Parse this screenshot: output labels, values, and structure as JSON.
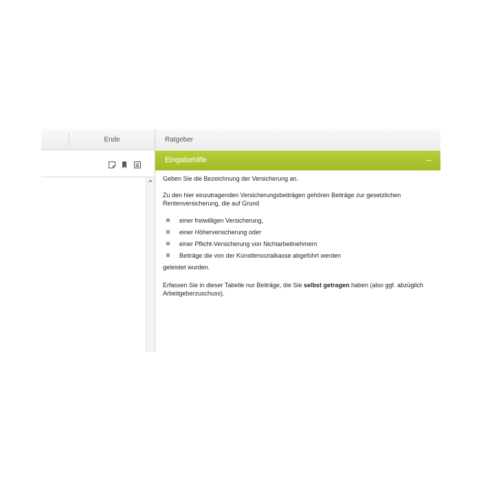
{
  "left": {
    "tab_label": "Ende",
    "toolbar_icons": [
      "note-icon",
      "bookmark-icon",
      "document-icon"
    ]
  },
  "right": {
    "tab_label": "Ratgeber",
    "panel_title": "Eingabehilfe",
    "content": {
      "p1": "Geben Sie die Bezeichnung der Versicherung an.",
      "p2": "Zu den hier einzutragenden Versicherungsbeiträgen gehören Beiträge zur gesetzlichen Rentenversicherung, die auf Grund",
      "list": [
        "einer freiwilligen Versicherung,",
        "einer Höherversicherung oder",
        "einer Pflicht-Versicherung von Nichtarbeitnehmern",
        "Beiträge die von der Künstlersozialkasse abgeführt werden"
      ],
      "p3": "geleistet wurden.",
      "p4_before": "Erfassen Sie in dieser Tabelle nur Beiträge, die Sie ",
      "p4_bold": "selbst getragen",
      "p4_after": " haben (also ggf. abzüglich Arbeitgeberzuschuss)."
    }
  },
  "colors": {
    "accent_green": "#a8be2a",
    "header_bg": "#efefef",
    "text": "#222222"
  }
}
